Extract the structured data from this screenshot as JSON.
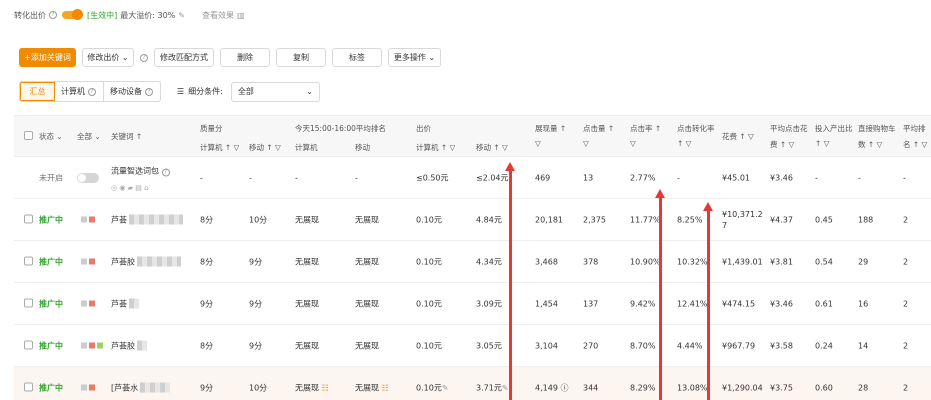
{
  "topbar": {
    "conversion_label": "转化出价",
    "status": "[生效中]",
    "max_premium": "最大溢价: 30%",
    "view_effect": "查看效果"
  },
  "toolbar": {
    "add_keyword": "+添加关键词",
    "modify_bid": "修改出价",
    "modify_match": "修改匹配方式",
    "delete": "删除",
    "copy": "复制",
    "tag": "标签",
    "more": "更多操作"
  },
  "filter": {
    "tabs": [
      "汇总",
      "计算机",
      "移动设备"
    ],
    "subdivide_label": "细分条件:",
    "subdivide_value": "全部"
  },
  "table": {
    "headers": {
      "status": "状态",
      "all": "全部",
      "keyword": "关键词 ↑",
      "quality": "质量分",
      "quality_pc": "计算机 ↑",
      "quality_mobile": "移动 ↑",
      "rank": "今天15:00-16:00平均排名",
      "rank_pc": "计算机",
      "rank_mobile": "移动",
      "bid": "出价",
      "bid_pc": "计算机 ↑",
      "bid_mobile": "移动 ↑",
      "impressions": "展现量 ↑",
      "clicks": "点击量 ↑",
      "ctr": "点击率 ↑",
      "cvr": "点击转化率",
      "cvr_sort": "↑",
      "cost": "花费 ↑",
      "avg_cpc_1": "平均点击花",
      "avg_cpc_2": "费 ↑",
      "roi_1": "投入产出比",
      "roi_2": "↑",
      "cart_1": "直接购物车",
      "cart_2": "数 ↑",
      "avg_rank_1": "平均排",
      "avg_rank_2": "名 ↑"
    },
    "rows": [
      {
        "status": "未开启",
        "keyword": "流量智选词包",
        "q_pc": "-",
        "q_mobile": "-",
        "r_pc": "-",
        "r_mobile": "-",
        "bid_pc": "≤0.50元",
        "bid_mobile": "≤2.04元",
        "impressions": "469",
        "clicks": "13",
        "ctr": "2.77%",
        "cvr": "-",
        "cost": "¥45.01",
        "cpc": "¥3.46",
        "roi": "-",
        "cart": "-",
        "rank": "-"
      },
      {
        "status": "推广中",
        "keyword": "芦荟",
        "q_pc": "8分",
        "q_mobile": "10分",
        "r_pc": "无展现",
        "r_mobile": "无展现",
        "bid_pc": "0.10元",
        "bid_mobile": "4.84元",
        "impressions": "20,181",
        "clicks": "2,375",
        "ctr": "11.77%",
        "cvr": "8.25%",
        "cost_1": "¥10,371.2",
        "cost_2": "7",
        "cpc": "¥4.37",
        "roi": "0.45",
        "cart": "188",
        "rank": "2"
      },
      {
        "status": "推广中",
        "keyword": "芦荟胶",
        "q_pc": "8分",
        "q_mobile": "9分",
        "r_pc": "无展现",
        "r_mobile": "无展现",
        "bid_pc": "0.10元",
        "bid_mobile": "4.34元",
        "impressions": "3,468",
        "clicks": "378",
        "ctr": "10.90%",
        "cvr": "10.32%",
        "cost": "¥1,439.01",
        "cpc": "¥3.81",
        "roi": "0.54",
        "cart": "29",
        "rank": "2"
      },
      {
        "status": "推广中",
        "keyword": "芦荟",
        "q_pc": "9分",
        "q_mobile": "9分",
        "r_pc": "无展现",
        "r_mobile": "无展现",
        "bid_pc": "0.10元",
        "bid_mobile": "3.09元",
        "impressions": "1,454",
        "clicks": "137",
        "ctr": "9.42%",
        "cvr": "12.41%",
        "cost": "¥474.15",
        "cpc": "¥3.46",
        "roi": "0.61",
        "cart": "16",
        "rank": "2"
      },
      {
        "status": "推广中",
        "keyword": "芦荟胶",
        "q_pc": "8分",
        "q_mobile": "9分",
        "r_pc": "无展现",
        "r_mobile": "无展现",
        "bid_pc": "0.10元",
        "bid_mobile": "3.05元",
        "impressions": "3,104",
        "clicks": "270",
        "ctr": "8.70%",
        "cvr": "4.44%",
        "cost": "¥967.79",
        "cpc": "¥3.58",
        "roi": "0.24",
        "cart": "14",
        "rank": "2"
      },
      {
        "status": "推广中",
        "keyword": "[芦荟水",
        "q_pc": "9分",
        "q_mobile": "10分",
        "r_pc": "无展现",
        "r_mobile": "无展现",
        "bid_pc": "0.10元",
        "bid_mobile": "3.71元",
        "impressions": "4,149",
        "clicks": "344",
        "ctr": "8.29%",
        "cvr": "13.08%",
        "cost": "¥1,290.04",
        "cpc": "¥3.75",
        "roi": "0.60",
        "cart": "28",
        "rank": "2"
      }
    ]
  },
  "colors": {
    "accent": "#f08a00",
    "active_status": "#2fa52f",
    "annotation_arrow": "#e53935"
  }
}
